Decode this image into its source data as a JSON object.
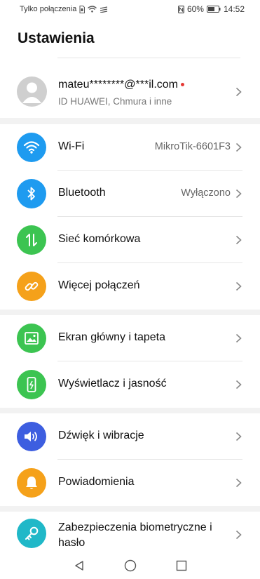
{
  "status_bar": {
    "carrier": "Tylko połączenia",
    "battery": "60%",
    "time": "14:52"
  },
  "header": {
    "title": "Ustawienia"
  },
  "account": {
    "email": "mateu********@***il.com",
    "subtitle": "ID HUAWEI, Chmura i inne"
  },
  "groups": [
    {
      "items": [
        {
          "label": "Wi-Fi",
          "value": "MikroTik-6601F3",
          "icon": "wifi-icon",
          "color": "#1e9bf0"
        },
        {
          "label": "Bluetooth",
          "value": "Wyłączono",
          "icon": "bluetooth-icon",
          "color": "#1e9bf0"
        },
        {
          "label": "Sieć komórkowa",
          "value": "",
          "icon": "mobile-data-icon",
          "color": "#3cc451"
        },
        {
          "label": "Więcej połączeń",
          "value": "",
          "icon": "link-icon",
          "color": "#f5a11a"
        }
      ]
    },
    {
      "items": [
        {
          "label": "Ekran główny i tapeta",
          "icon": "wallpaper-icon",
          "color": "#3cc451"
        },
        {
          "label": "Wyświetlacz i jasność",
          "icon": "display-brightness-icon",
          "color": "#3cc451"
        }
      ]
    },
    {
      "items": [
        {
          "label": "Dźwięk i wibracje",
          "icon": "sound-icon",
          "color": "#3d5ee0"
        },
        {
          "label": "Powiadomienia",
          "icon": "bell-icon",
          "color": "#f5a11a"
        }
      ]
    },
    {
      "items": [
        {
          "label_line1": "Zabezpieczenia biometryczne i",
          "label_line2": "hasło",
          "icon": "key-icon",
          "color": "#20b8c8"
        }
      ]
    }
  ]
}
